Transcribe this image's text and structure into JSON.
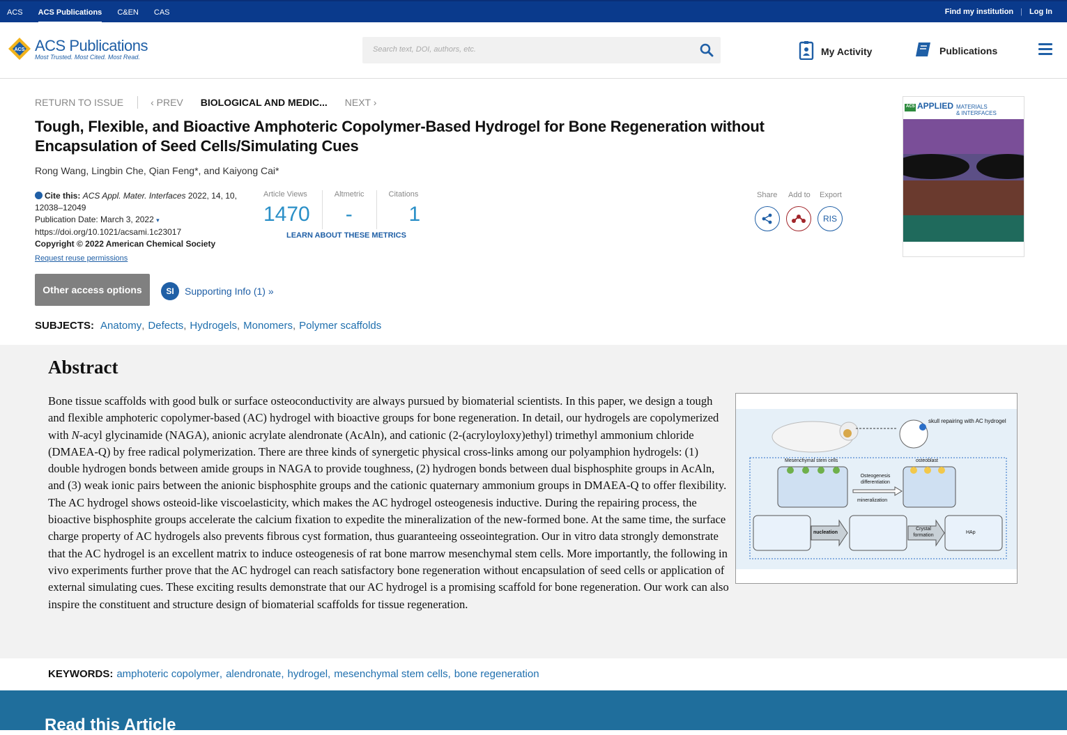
{
  "topbar": {
    "links": [
      "ACS",
      "ACS Publications",
      "C&EN",
      "CAS"
    ],
    "active_index": 1,
    "find_institution": "Find my institution",
    "login": "Log In"
  },
  "header": {
    "logo_main": "ACS Publications",
    "logo_sub": "Most Trusted. Most Cited. Most Read.",
    "search_placeholder": "Search text, DOI, authors, etc.",
    "my_activity": "My Activity",
    "publications": "Publications"
  },
  "artnav": {
    "return": "RETURN TO ISSUE",
    "prev": "‹ PREV",
    "current": "BIOLOGICAL AND MEDIC...",
    "next": "NEXT ›"
  },
  "article": {
    "title": "Tough, Flexible, and Bioactive Amphoteric Copolymer-Based Hydrogel for Bone Regeneration without Encapsulation of Seed Cells/Simulating Cues",
    "authors": "Rong Wang, Lingbin Che, Qian Feng*, and Kaiyong Cai*",
    "cite_label": "Cite this:",
    "cite_journal": "ACS Appl. Mater. Interfaces",
    "cite_rest": " 2022, 14, 10, 12038–12049",
    "pub_date": "Publication Date: March 3, 2022",
    "doi": "https://doi.org/10.1021/acsami.1c23017",
    "copyright": "Copyright © 2022 American Chemical Society",
    "reuse": "Request reuse permissions"
  },
  "metrics": {
    "views_label": "Article Views",
    "views": "1470",
    "altmetric_label": "Altmetric",
    "altmetric": "-",
    "citations_label": "Citations",
    "citations": "1",
    "learn": "LEARN ABOUT THESE METRICS"
  },
  "actions": {
    "share": "Share",
    "add_to": "Add to",
    "export": "Export",
    "ris": "RIS"
  },
  "cover": {
    "acs": "ACS",
    "applied": "APPLIED",
    "materials": "MATERIALS",
    "interfaces": "& INTERFACES"
  },
  "access": {
    "other": "Other access options",
    "si_badge": "SI",
    "si_label": "Supporting Info (1) »"
  },
  "subjects": {
    "head": "SUBJECTS:",
    "items": [
      "Anatomy",
      "Defects",
      "Hydrogels",
      "Monomers",
      "Polymer scaffolds"
    ]
  },
  "abstract": {
    "title": "Abstract",
    "text_part1": "Bone tissue scaffolds with good bulk or surface osteoconductivity are always pursued by biomaterial scientists. In this paper, we design a tough and flexible amphoteric copolymer-based (AC) hydrogel with bioactive groups for bone regeneration. In detail, our hydrogels are copolymerized with ",
    "text_italic": "N",
    "text_part2": "-acyl glycinamide (NAGA), anionic acrylate alendronate (AcAln), and cationic (2-(acryloyloxy)ethyl) trimethyl ammonium chloride (DMAEA-Q) by free radical polymerization. There are three kinds of synergetic physical cross-links among our polyamphion hydrogels: (1) double hydrogen bonds between amide groups in NAGA to provide toughness, (2) hydrogen bonds between dual bisphosphite groups in AcAln, and (3) weak ionic pairs between the anionic bisphosphite groups and the cationic quaternary ammonium groups in DMAEA-Q to offer flexibility. The AC hydrogel shows osteoid-like viscoelasticity, which makes the AC hydrogel osteogenesis inductive. During the repairing process, the bioactive bisphosphite groups accelerate the calcium fixation to expedite the mineralization of the new-formed bone. At the same time, the surface charge property of AC hydrogels also prevents fibrous cyst formation, thus guaranteeing osseointegration. Our in vitro data strongly demonstrate that the AC hydrogel is an excellent matrix to induce osteogenesis of rat bone marrow mesenchymal stem cells. More importantly, the following in vivo experiments further prove that the AC hydrogel can reach satisfactory bone regeneration without encapsulation of seed cells or application of external simulating cues. These exciting results demonstrate that our AC hydrogel is a promising scaffold for bone regeneration. Our work can also inspire the constituent and structure design of biomaterial scaffolds for tissue regeneration.",
    "figure": {
      "skull_label": "skull repairing with AC hydrogel",
      "msc_label": "Mesenchymal stem cells",
      "osteoblast_label": "osteoblast",
      "osteo_diff": "Osteogenesis differentiation",
      "mineralization": "mineralization",
      "nucleation": "nucleation",
      "crystal": "Crystal formation",
      "hap": "HAp"
    }
  },
  "keywords": {
    "head": "KEYWORDS:",
    "items": [
      "amphoteric copolymer",
      "alendronate",
      "hydrogel",
      "mesenchymal stem cells",
      "bone regeneration"
    ]
  },
  "read": {
    "title": "Read this Article"
  },
  "colors": {
    "topbar": "#0a3a8c",
    "brand_blue": "#1f5fa6",
    "metric_blue": "#2a8fc7",
    "read_band": "#1f6e9c"
  }
}
